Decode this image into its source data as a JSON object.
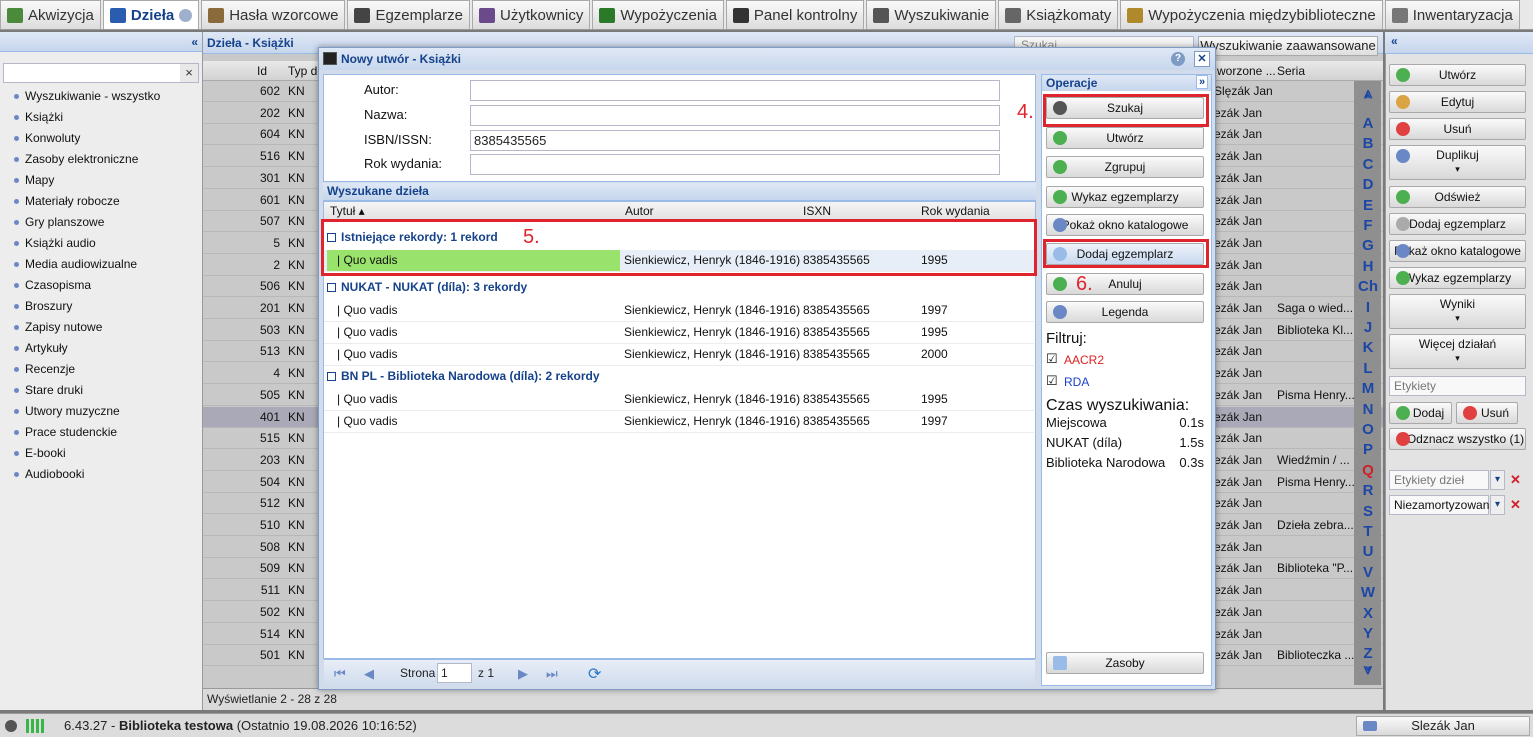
{
  "tabs": [
    {
      "label": "Akwizycja",
      "active": false
    },
    {
      "label": "Dzieła",
      "active": true
    },
    {
      "label": "Hasła wzorcowe",
      "active": false
    },
    {
      "label": "Egzemplarze",
      "active": false
    },
    {
      "label": "Użytkownicy",
      "active": false
    },
    {
      "label": "Wypożyczenia",
      "active": false
    },
    {
      "label": "Panel kontrolny",
      "active": false
    },
    {
      "label": "Wyszukiwanie",
      "active": false
    },
    {
      "label": "Książkomaty",
      "active": false
    },
    {
      "label": "Wypożyczenia międzybiblioteczne",
      "active": false
    },
    {
      "label": "Inwentaryzacja",
      "active": false
    }
  ],
  "left": {
    "collapse": "«",
    "clear": "×",
    "items": [
      "Wyszukiwanie - wszystko",
      "Książki",
      "Konwoluty",
      "Zasoby elektroniczne",
      "Mapy",
      "Materiały robocze",
      "Gry planszowe",
      "Książki audio",
      "Media audiowizualne",
      "Czasopisma",
      "Broszury",
      "Zapisy nutowe",
      "Artykuły",
      "Recenzje",
      "Stare druki",
      "Utwory muzyczne",
      "Prace studenckie",
      "E-booki",
      "Audiobooki"
    ]
  },
  "grid": {
    "title": "Dzieła - Książki",
    "search_placeholder": "Szukaj",
    "advanced": "Wyszukiwanie zaawansowane",
    "col_id": "Id",
    "col_typ": "Typ d",
    "col_tworzone": "worzone ...",
    "col_seria": "Seria",
    "rows": [
      {
        "id": "602",
        "typ": "KN",
        "tw": "Slęzák Jan",
        "seria": ""
      },
      {
        "id": "202",
        "typ": "KN",
        "tw": "ezák Jan",
        "seria": ""
      },
      {
        "id": "604",
        "typ": "KN",
        "tw": "ezák Jan",
        "seria": ""
      },
      {
        "id": "516",
        "typ": "KN",
        "tw": "ezák Jan",
        "seria": ""
      },
      {
        "id": "301",
        "typ": "KN",
        "tw": "ezák Jan",
        "seria": ""
      },
      {
        "id": "601",
        "typ": "KN",
        "tw": "ezák Jan",
        "seria": ""
      },
      {
        "id": "507",
        "typ": "KN",
        "tw": "ezák Jan",
        "seria": ""
      },
      {
        "id": "5",
        "typ": "KN",
        "tw": "ezák Jan",
        "seria": ""
      },
      {
        "id": "2",
        "typ": "KN",
        "tw": "ezák Jan",
        "seria": ""
      },
      {
        "id": "506",
        "typ": "KN",
        "tw": "ezák Jan",
        "seria": ""
      },
      {
        "id": "201",
        "typ": "KN",
        "tw": "ezák Jan",
        "seria": "Saga o wied..."
      },
      {
        "id": "503",
        "typ": "KN",
        "tw": "ezák Jan",
        "seria": "Biblioteka Kl..."
      },
      {
        "id": "513",
        "typ": "KN",
        "tw": "ezák Jan",
        "seria": ""
      },
      {
        "id": "4",
        "typ": "KN",
        "tw": "ezák Jan",
        "seria": ""
      },
      {
        "id": "505",
        "typ": "KN",
        "tw": "ezák Jan",
        "seria": "Pisma Henry..."
      },
      {
        "id": "401",
        "typ": "KN",
        "tw": "ezák Jan",
        "seria": ""
      },
      {
        "id": "515",
        "typ": "KN",
        "tw": "ezák Jan",
        "seria": ""
      },
      {
        "id": "203",
        "typ": "KN",
        "tw": "ezák Jan",
        "seria": "Wiedźmin / ..."
      },
      {
        "id": "504",
        "typ": "KN",
        "tw": "ezák Jan",
        "seria": "Pisma Henry..."
      },
      {
        "id": "512",
        "typ": "KN",
        "tw": "ezák Jan",
        "seria": ""
      },
      {
        "id": "510",
        "typ": "KN",
        "tw": "ezák Jan",
        "seria": "Dzieła zebra..."
      },
      {
        "id": "508",
        "typ": "KN",
        "tw": "ezák Jan",
        "seria": ""
      },
      {
        "id": "509",
        "typ": "KN",
        "tw": "ezák Jan",
        "seria": "Biblioteka \"P..."
      },
      {
        "id": "511",
        "typ": "KN",
        "tw": "ezák Jan",
        "seria": ""
      },
      {
        "id": "502",
        "typ": "KN",
        "tw": "ezák Jan",
        "seria": ""
      },
      {
        "id": "514",
        "typ": "KN",
        "tw": "ezák Jan",
        "seria": ""
      },
      {
        "id": "501",
        "typ": "KN",
        "tw": "ezák Jan",
        "seria": "Biblioteczka ..."
      }
    ],
    "footer": "Wyświetlanie 2 - 28 z 28"
  },
  "alphabet": [
    "A",
    "B",
    "C",
    "D",
    "E",
    "F",
    "G",
    "H",
    "Ch",
    "I",
    "J",
    "K",
    "L",
    "M",
    "N",
    "O",
    "P",
    "Q",
    "R",
    "S",
    "T",
    "U",
    "V",
    "W",
    "X",
    "Y",
    "Z"
  ],
  "right": {
    "collapse": "«",
    "buttons": [
      "Utwórz",
      "Edytuj",
      "Usuń",
      "Duplikuj",
      "Odśwież",
      "Dodaj egzemplarz",
      "Pokaż okno katalogowe",
      "Wykaz egzemplarzy",
      "Wyniki",
      "Więcej działań"
    ],
    "labels_placeholder": "Etykiety",
    "add": "Dodaj",
    "remove": "Usuń",
    "unmark": "Odznacz wszystko (1)",
    "work_labels": "Etykiety dzieł",
    "unamortized": "Niezamortyzowan",
    "dropdown": "▾",
    "clear": "✕"
  },
  "modal": {
    "title": "Nowy utwór - Książki",
    "help": "?",
    "close": "✕",
    "fields": [
      {
        "label": "Autor:",
        "value": ""
      },
      {
        "label": "Nazwa:",
        "value": ""
      },
      {
        "label": "ISBN/ISSN:",
        "value": "8385435565"
      },
      {
        "label": "Rok wydania:",
        "value": ""
      }
    ],
    "results_title": "Wyszukane dzieła",
    "columns": {
      "title": "Tytuł ▴",
      "author": "Autor",
      "isxn": "ISXN",
      "year": "Rok wydania"
    },
    "groups": [
      {
        "name": "Istniejące rekordy: 1 rekord",
        "rows": [
          {
            "title": "| Quo vadis",
            "author": "Sienkiewicz, Henryk (1846-1916)",
            "isxn": "8385435565",
            "year": "1995"
          }
        ]
      },
      {
        "name": "NUKAT - NUKAT (díla): 3 rekordy",
        "rows": [
          {
            "title": "| Quo vadis",
            "author": "Sienkiewicz, Henryk (1846-1916)",
            "isxn": "8385435565",
            "year": "1997"
          },
          {
            "title": "| Quo vadis",
            "author": "Sienkiewicz, Henryk (1846-1916)",
            "isxn": "8385435565",
            "year": "1995"
          },
          {
            "title": "| Quo vadis",
            "author": "Sienkiewicz, Henryk (1846-1916)",
            "isxn": "8385435565",
            "year": "2000"
          }
        ]
      },
      {
        "name": "BN PL - Biblioteka Narodowa (díla): 2 rekordy",
        "rows": [
          {
            "title": "| Quo vadis",
            "author": "Sienkiewicz, Henryk (1846-1916)",
            "isxn": "8385435565",
            "year": "1995"
          },
          {
            "title": "| Quo vadis",
            "author": "Sienkiewicz, Henryk (1846-1916)",
            "isxn": "8385435565",
            "year": "1997"
          }
        ]
      }
    ],
    "pager": {
      "label": "Strona",
      "page": "1",
      "of": "z 1"
    },
    "ops_title": "Operacje",
    "ops_collapse": "»",
    "ops": [
      "Szukaj",
      "Utwórz",
      "Zgrupuj",
      "Wykaz egzemplarzy",
      "Pokaż okno katalogowe",
      "Dodaj egzemplarz",
      "Anuluj",
      "Legenda"
    ],
    "filter_title": "Filtruj:",
    "filters": [
      {
        "label": "AACR2",
        "color": "#e02020",
        "checked": "☑"
      },
      {
        "label": "RDA",
        "color": "#1c3fc8",
        "checked": "☑"
      }
    ],
    "time_title": "Czas wyszukiwania:",
    "times": [
      {
        "src": "Miejscowa",
        "t": "0.1s"
      },
      {
        "src": "NUKAT (díla)",
        "t": "1.5s"
      },
      {
        "src": "Biblioteka Narodowa ...",
        "t": "0.3s"
      }
    ],
    "zasoby": "Zasoby"
  },
  "annotations": {
    "a4": "4.",
    "a5": "5.",
    "a6": "6."
  },
  "status": {
    "version": "6.43.27 - ",
    "library": "Biblioteka testowa",
    "last": " (Ostatnio 19.08.2026 10:16:52)",
    "user": "Slezák Jan"
  },
  "colors": {
    "selected_row": "#99e26b",
    "highlight": "#e0242e",
    "accent": "#15428b"
  }
}
